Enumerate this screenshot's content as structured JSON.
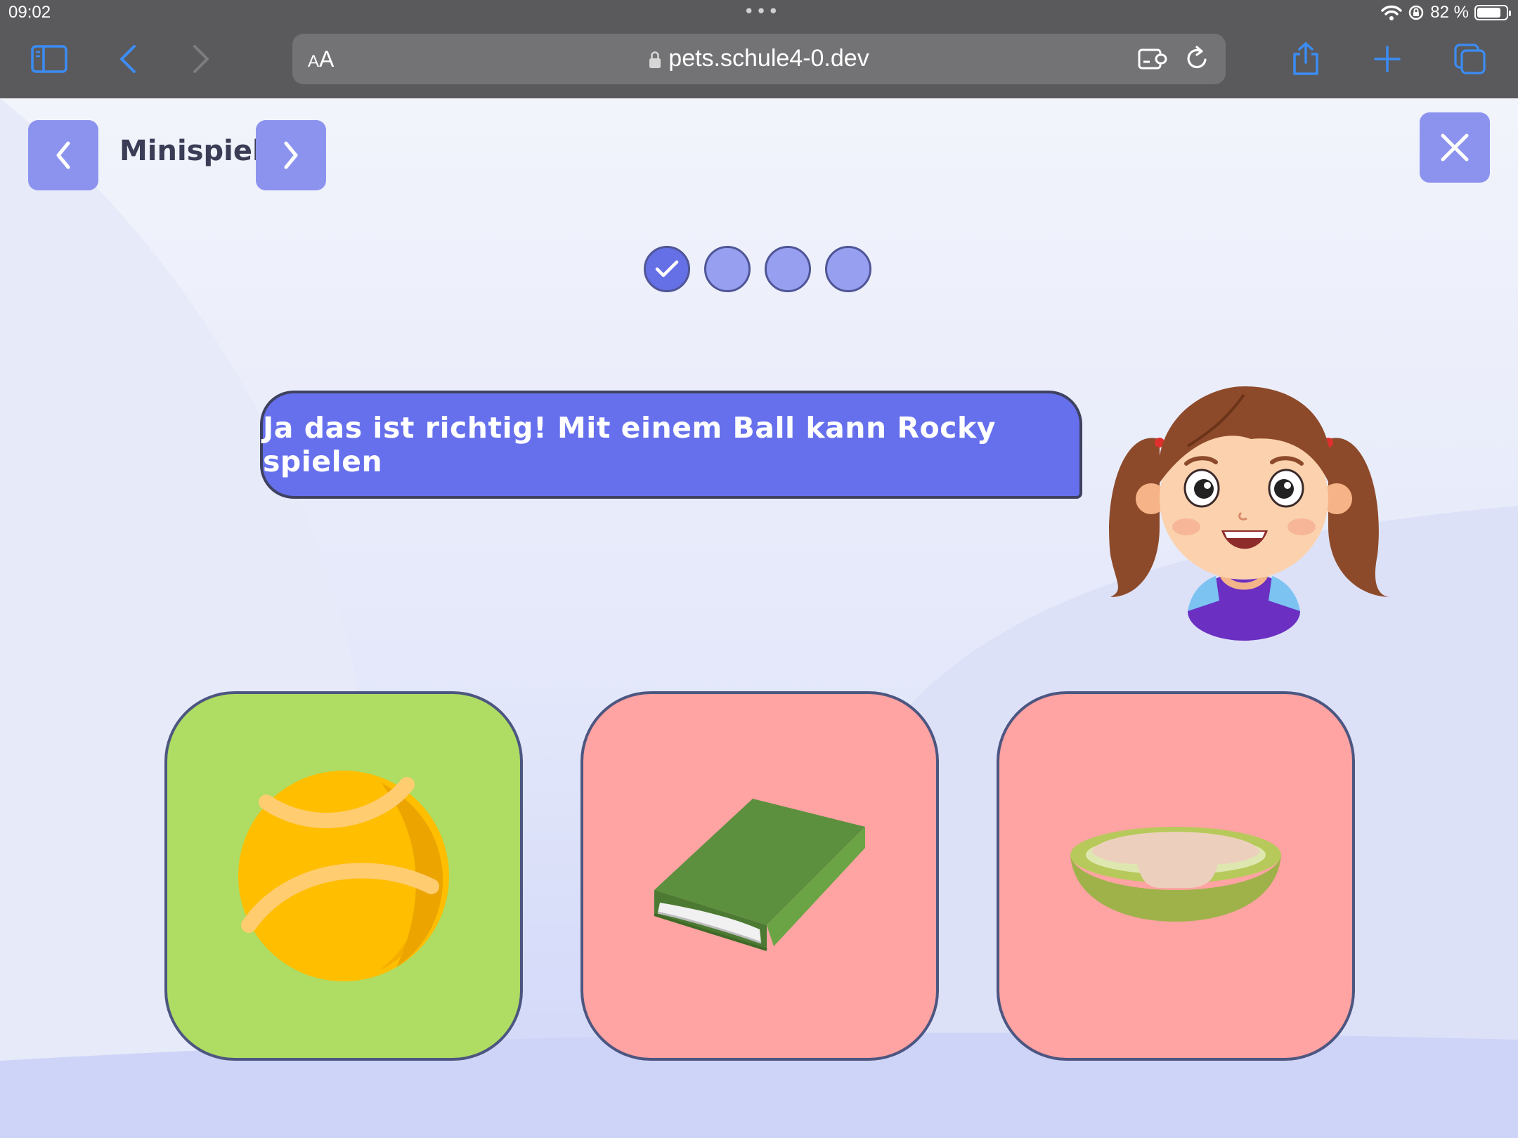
{
  "status_bar": {
    "time": "09:02",
    "dots": "•••",
    "battery": "82 %",
    "battery_level": 0.82
  },
  "browser": {
    "text_size_small": "A",
    "text_size_big": "A",
    "url": "pets.schule4-0.dev",
    "icons": [
      "sidebar-icon",
      "back-icon",
      "forward-icon",
      "lock-icon",
      "extension-icon",
      "reload-icon",
      "share-icon",
      "new-tab-icon",
      "tabs-icon"
    ]
  },
  "header": {
    "title": "Minispiel",
    "icons": [
      "chevron-left-icon",
      "chevron-right-icon",
      "close-icon"
    ]
  },
  "progress": {
    "steps": [
      {
        "state": "done"
      },
      {
        "state": "pending"
      },
      {
        "state": "pending"
      },
      {
        "state": "pending"
      }
    ],
    "completed": 1,
    "total": 4
  },
  "speech": {
    "text": "Ja das ist richtig! Mit einem Ball kann Rocky spielen"
  },
  "answers": [
    {
      "item": "ball",
      "state": "correct",
      "color": "#afdc62"
    },
    {
      "item": "book",
      "state": "wrong",
      "color": "#ffa3a3"
    },
    {
      "item": "pet-bed",
      "state": "wrong",
      "color": "#ffa3a3"
    }
  ],
  "colors": {
    "accent": "#6670ed",
    "button": "#8c93ee",
    "correct": "#afdc62",
    "wrong": "#ffa3a3",
    "browser_link": "#3b8cf5"
  }
}
